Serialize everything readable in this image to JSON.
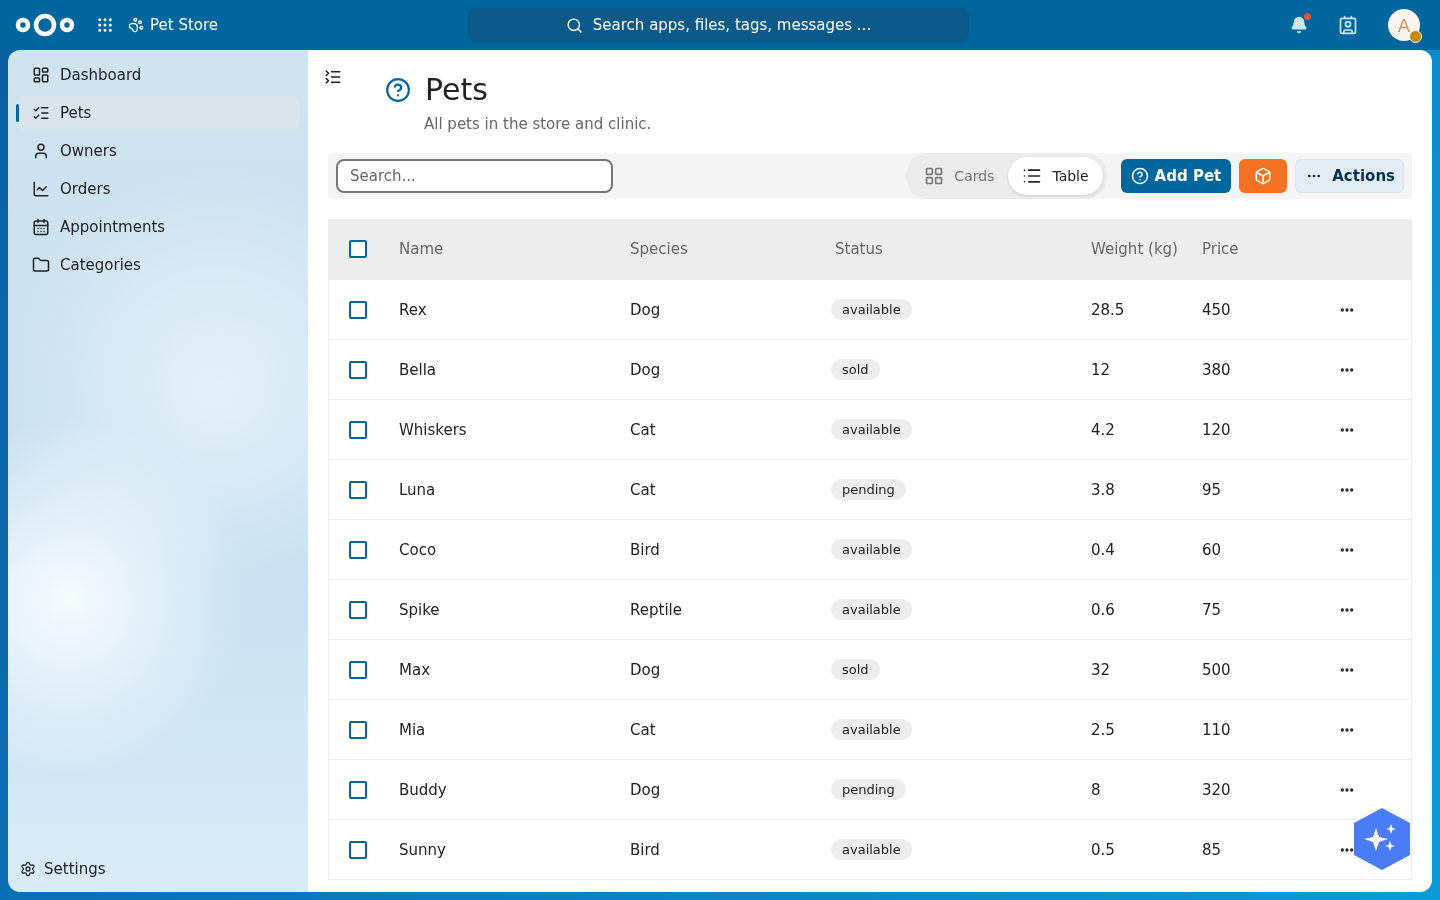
{
  "header": {
    "app_name": "Pet Store",
    "search_placeholder": "Search apps, files, tags, messages ...",
    "notification_unread": true,
    "avatar_initial": "A"
  },
  "sidebar": {
    "items": [
      {
        "label": "Dashboard",
        "selected": false
      },
      {
        "label": "Pets",
        "selected": true
      },
      {
        "label": "Owners",
        "selected": false
      },
      {
        "label": "Orders",
        "selected": false
      },
      {
        "label": "Appointments",
        "selected": false
      },
      {
        "label": "Categories",
        "selected": false
      }
    ],
    "settings": "Settings"
  },
  "page": {
    "title": "Pets",
    "subtitle": "All pets in the store and clinic."
  },
  "toolbar": {
    "search_placeholder": "Search...",
    "views": [
      {
        "label": "Cards",
        "selected": false
      },
      {
        "label": "Table",
        "selected": true
      }
    ],
    "add_button": "Add Pet",
    "actions_button": "Actions"
  },
  "table": {
    "columns": [
      "Name",
      "Species",
      "Status",
      "Weight (kg)",
      "Price"
    ],
    "all_checked": false,
    "rows": [
      {
        "name": "Rex",
        "species": "Dog",
        "status": "available",
        "weight": "28.5",
        "price": "450",
        "checked": false
      },
      {
        "name": "Bella",
        "species": "Dog",
        "status": "sold",
        "weight": "12",
        "price": "380",
        "checked": false
      },
      {
        "name": "Whiskers",
        "species": "Cat",
        "status": "available",
        "weight": "4.2",
        "price": "120",
        "checked": false
      },
      {
        "name": "Luna",
        "species": "Cat",
        "status": "pending",
        "weight": "3.8",
        "price": "95",
        "checked": false
      },
      {
        "name": "Coco",
        "species": "Bird",
        "status": "available",
        "weight": "0.4",
        "price": "60",
        "checked": false
      },
      {
        "name": "Spike",
        "species": "Reptile",
        "status": "available",
        "weight": "0.6",
        "price": "75",
        "checked": false
      },
      {
        "name": "Max",
        "species": "Dog",
        "status": "sold",
        "weight": "32",
        "price": "500",
        "checked": false
      },
      {
        "name": "Mia",
        "species": "Cat",
        "status": "available",
        "weight": "2.5",
        "price": "110",
        "checked": false
      },
      {
        "name": "Buddy",
        "species": "Dog",
        "status": "pending",
        "weight": "8",
        "price": "320",
        "checked": false
      },
      {
        "name": "Sunny",
        "species": "Bird",
        "status": "available",
        "weight": "0.5",
        "price": "85",
        "checked": false
      }
    ]
  }
}
